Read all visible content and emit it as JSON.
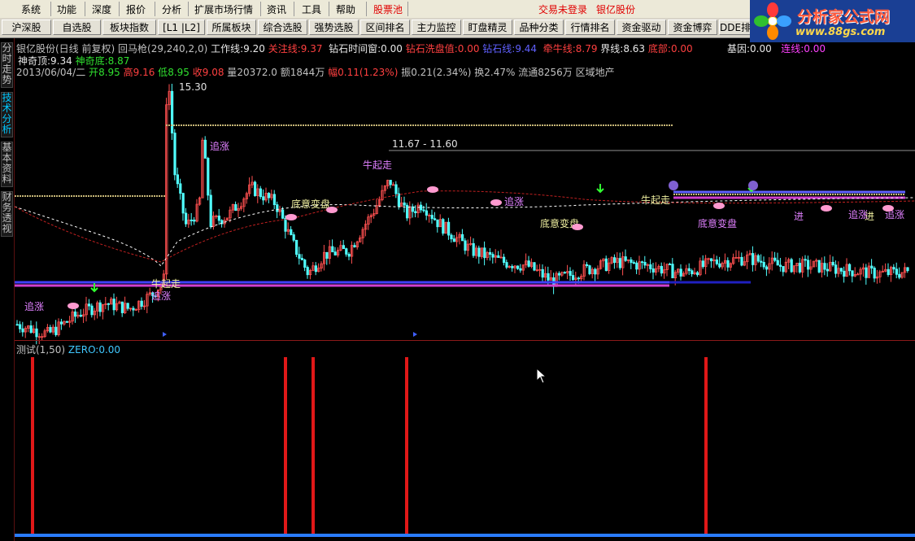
{
  "menu": {
    "items": [
      "系统",
      "功能",
      "深度",
      "报价",
      "分析",
      "扩展市场行情",
      "资讯",
      "工具",
      "帮助"
    ],
    "highlight": "股票池",
    "login_status": "交易未登录",
    "stock_name": "银亿股份"
  },
  "toolbar": {
    "buttons": [
      "沪深股",
      "自选股",
      "板块指数",
      "[L1 |L2]",
      "所属板块",
      "综合选股",
      "强势选股",
      "区间排名",
      "主力监控",
      "盯盘精灵",
      "品种分类",
      "行情排名",
      "资金驱动",
      "资金博弈",
      "DDE排"
    ]
  },
  "logo": {
    "title": "分析家公式网",
    "url": "www.88gs.com"
  },
  "side_tabs": [
    "分时走势",
    "技术分析",
    "基本资料",
    "财务透视"
  ],
  "indicator": {
    "title": "银亿股份(日线 前复权)",
    "name": "回马枪(29,240,2,0)",
    "work_line_label": "工作线:",
    "work_line": "9.20",
    "attention_label": "关注线:",
    "attention": "9.37",
    "diamond_time_label": "钻石时间窗:",
    "diamond_time": "0.00",
    "diamond_wash_label": "钻石洗盘值:",
    "diamond_wash": "0.00",
    "diamond_line_label": "钻石线:",
    "diamond_line": "9.44",
    "bull_line_label": "牵牛线:",
    "bull_line": "8.79",
    "boundary_label": "界线:",
    "boundary": "8.63",
    "bottom_label": "底部:",
    "bottom": "0.00",
    "gene_label": "基因:",
    "gene": "0.00",
    "link_label": "连线:",
    "link": "0.00",
    "magic_top_label": "神奇顶:",
    "magic_top": "9.34",
    "magic_bottom_label": "神奇底:",
    "magic_bottom": "8.87"
  },
  "quote": {
    "date": "2013/06/04/二",
    "open_label": "开",
    "open": "8.95",
    "high_label": "高",
    "high": "9.16",
    "low_label": "低",
    "low": "8.95",
    "close_label": "收",
    "close": "9.08",
    "vol_label": "量",
    "vol": "20372.0",
    "amount_label": "额",
    "amount": "1844万",
    "change_label": "幅",
    "change": "0.11(1.23%)",
    "amp_label": "振",
    "amp": "0.21(2.34%)",
    "turnover_label": "换",
    "turnover": "2.47%",
    "float_label": "流通",
    "float": "8256万",
    "sector": "区域地产"
  },
  "price_annotations": {
    "peak": "15.30",
    "range": "11.67 - 11.60"
  },
  "signals": [
    "追涨",
    "牛起走",
    "追涨",
    "牛起走",
    "底意变盘",
    "追涨",
    "追涨",
    "牛起走",
    "追涨",
    "进",
    "进",
    "追涨",
    "底意变盘",
    "底意变盘"
  ],
  "lower_panel": {
    "name": "测试(1,50)",
    "zero_label": "ZERO:",
    "zero": "0.00"
  },
  "colors": {
    "background": "#000000",
    "up": "#ff5050",
    "down": "#50ffff",
    "grid": "#8b1a1a",
    "signal_bar": "#e01818",
    "baseline": "#2a7cff"
  },
  "chart_data": {
    "type": "bar",
    "title": "测试(1,50)",
    "series": [
      {
        "name": "测试",
        "values": [
          1,
          1,
          1,
          1,
          1
        ]
      }
    ],
    "x": [
      1,
      2,
      3,
      4,
      5
    ],
    "ylim": [
      0,
      1
    ]
  }
}
